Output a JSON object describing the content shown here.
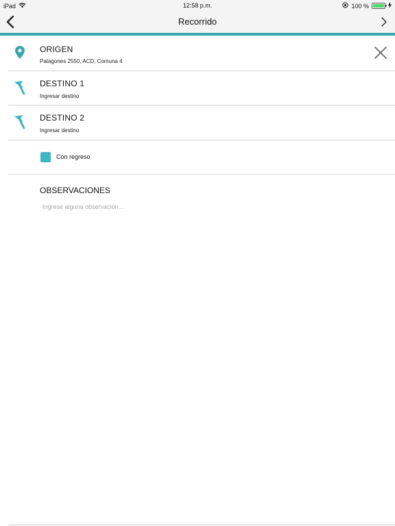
{
  "status_bar": {
    "device": "iPad",
    "time": "12:58 p.m.",
    "battery": "100 %",
    "battery_level": 1.0
  },
  "nav": {
    "title": "Recorrido",
    "back_icon": "chevron-left-icon",
    "next_icon": "chevron-right-icon",
    "accent_color": "#3aa5ad"
  },
  "route": {
    "origin": {
      "title": "ORIGEN",
      "subtitle": "Patagones 2550, ACD, Comuna 4",
      "icon": "location-pin-icon"
    },
    "destinations": [
      {
        "title": "DESTINO 1",
        "subtitle": "Ingresar destino",
        "icon": "flag-icon"
      },
      {
        "title": "DESTINO 2",
        "subtitle": "Ingresar destino",
        "icon": "flag-icon"
      }
    ],
    "return_trip": {
      "label": "Con regreso",
      "checked": true,
      "color": "#3db5c5"
    }
  },
  "observations": {
    "title": "OBSERVACIONES",
    "placeholder": "Ingrese alguna observación...",
    "value": ""
  }
}
